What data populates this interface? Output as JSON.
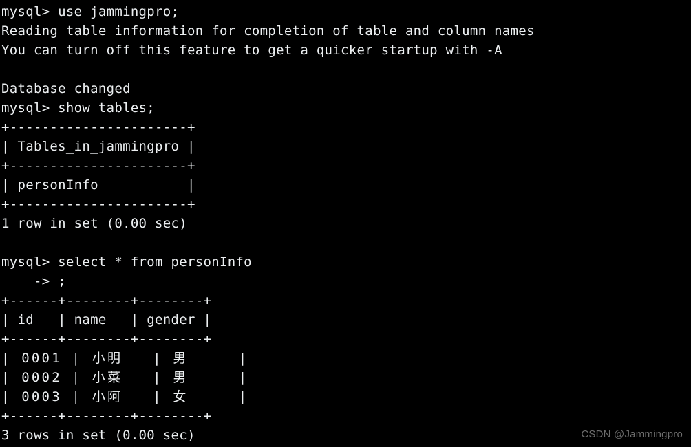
{
  "terminal": {
    "background_color": "#000000",
    "foreground_color": "#eceff1",
    "prompt": "mysql>",
    "continuation_prompt": "->",
    "lines": [
      {
        "id": "cmd-use-db",
        "text": "mysql> use jammingpro;"
      },
      {
        "id": "msg-reading-table",
        "text": "Reading table information for completion of table and column names"
      },
      {
        "id": "msg-turn-off-hint",
        "text": "You can turn off this feature to get a quicker startup with -A"
      },
      {
        "id": "blank-1",
        "text": ""
      },
      {
        "id": "msg-db-changed",
        "text": "Database changed"
      },
      {
        "id": "cmd-show-tables",
        "text": "mysql> show tables;"
      },
      {
        "id": "tbl1-border-top",
        "text": "+----------------------+"
      },
      {
        "id": "tbl1-header",
        "text": "| Tables_in_jammingpro |"
      },
      {
        "id": "tbl1-border-mid",
        "text": "+----------------------+"
      },
      {
        "id": "tbl1-row-1",
        "text": "| personInfo           |"
      },
      {
        "id": "tbl1-border-bot",
        "text": "+----------------------+"
      },
      {
        "id": "tbl1-result",
        "text": "1 row in set (0.00 sec)"
      },
      {
        "id": "blank-2",
        "text": ""
      },
      {
        "id": "cmd-select",
        "text": "mysql> select * from personInfo"
      },
      {
        "id": "cmd-select-cont",
        "text": "    -> ;"
      },
      {
        "id": "tbl2-border-top",
        "text": "+------+--------+--------+"
      },
      {
        "id": "tbl2-header",
        "text": "| id   | name   | gender |"
      },
      {
        "id": "tbl2-border-mid",
        "text": "+------+--------+--------+"
      },
      {
        "id": "tbl2-row-1",
        "text": "| 0001 | 小明   | 男     |",
        "cjk": true
      },
      {
        "id": "tbl2-row-2",
        "text": "| 0002 | 小菜   | 男     |",
        "cjk": true
      },
      {
        "id": "tbl2-row-3",
        "text": "| 0003 | 小阿   | 女     |",
        "cjk": true
      },
      {
        "id": "tbl2-border-bot",
        "text": "+------+--------+--------+"
      },
      {
        "id": "tbl2-result",
        "text": "3 rows in set (0.00 sec)"
      }
    ]
  },
  "commands": {
    "use_database": "use jammingpro;",
    "show_tables": "show tables;",
    "select_all": "select * from personInfo",
    "select_terminator": ";"
  },
  "database": {
    "name": "jammingpro",
    "status_message": "Database changed"
  },
  "tables_list": {
    "column_header": "Tables_in_jammingpro",
    "rows": [
      "personInfo"
    ],
    "result_text": "1 row in set (0.00 sec)",
    "row_count": 1,
    "duration": "0.00 sec"
  },
  "person_info": {
    "table_name": "personInfo",
    "columns": [
      "id",
      "name",
      "gender"
    ],
    "rows": [
      [
        "0001",
        "小明",
        "男"
      ],
      [
        "0002",
        "小菜",
        "男"
      ],
      [
        "0003",
        "小阿",
        "女"
      ]
    ],
    "result_text": "3 rows in set (0.00 sec)",
    "row_count": 3,
    "duration": "0.00 sec"
  },
  "watermark": {
    "text": "CSDN @Jammingpro",
    "color": "#6d6d6d"
  }
}
